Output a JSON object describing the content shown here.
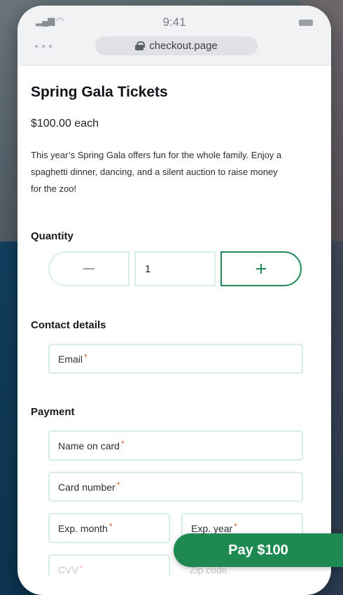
{
  "status_bar": {
    "time": "9:41"
  },
  "browser": {
    "url": "checkout.page"
  },
  "product": {
    "title": "Spring Gala Tickets",
    "price": "$100.00 each",
    "description": "This year’s Spring Gala offers fun for the whole family. Enjoy a spaghetti dinner, dancing, and a silent auction to raise money for the zoo!"
  },
  "quantity": {
    "label": "Quantity",
    "value": "1"
  },
  "contact": {
    "label": "Contact details",
    "email_placeholder": "Email"
  },
  "payment": {
    "label": "Payment",
    "name_placeholder": "Name on card",
    "card_placeholder": "Card number",
    "exp_month_placeholder": "Exp. month",
    "exp_year_placeholder": "Exp. year",
    "cvv_placeholder": "CVV",
    "zip_placeholder": "Zip code"
  },
  "required_marker": "*",
  "pay_button": {
    "label": "Pay $100"
  },
  "colors": {
    "accent": "#1e8a52",
    "field_border": "#d8eee2",
    "required": "#e0533a"
  }
}
